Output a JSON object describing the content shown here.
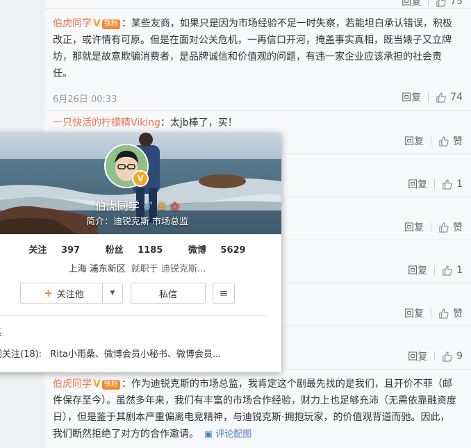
{
  "comments": [
    {
      "id": "top_partial",
      "likes": "75",
      "reply_label": "回复"
    },
    {
      "id": "c1",
      "user": "伯虎同学",
      "badge": "铁粉",
      "text": "：某些友商，如果只是因为市场经验不足一时失察，若能坦白承认错误，积极改正，或许情有可原。但是在面对公关危机，一再信口开河，掩盖事实真相，既当婊子又立牌坊，那就是故意欺骗消费者，是品牌诚信和价值观的问题，有违一家企业应该承担的社会责任。",
      "time": "6月26日 00:33",
      "reply_label": "回复",
      "likes": "74"
    },
    {
      "id": "c2",
      "user": "一只快活的柠檬精Viking",
      "text": "：太jb棒了，买！",
      "reply_label": "回复",
      "likes": "赞"
    },
    {
      "id": "c3",
      "reply_label": "回复",
      "likes": "1"
    },
    {
      "id": "c4",
      "reply_label": "回复",
      "likes": "赞"
    },
    {
      "id": "c5",
      "reply_label": "回复",
      "likes": "1"
    },
    {
      "id": "c6",
      "reply_label": "回复",
      "likes": "赞"
    },
    {
      "id": "c7",
      "reply_label": "回复",
      "likes": "9"
    },
    {
      "id": "c8",
      "user": "伯虎同学",
      "badge": "铁粉",
      "text": "：作为迪锐克斯的市场总监，我肯定这个剧最先找的是我们，且开价不菲（邮件保存至今）。虽然多年来，我们有丰富的市场合作经验，财力上也足够充沛（无需依靠融资度日），但是鉴于其剧本严重偏离电竞精神，与迪锐克斯·拥抱玩家，的价值观背道而驰。因此，我们断然拒绝了对方的合作邀请。",
      "link": "评论配图"
    }
  ],
  "card": {
    "name": "伯虎同学",
    "intro": "简介：迪锐克斯 市场总监",
    "following_label": "关注",
    "following": "397",
    "fans_label": "粉丝",
    "fans": "1185",
    "weibo_label": "微博",
    "weibo": "5629",
    "location": "上海 浦东新区",
    "job": "就职于 迪锐克斯...",
    "follow_btn": "关注他",
    "message_btn": "私信",
    "partial_line1": "系",
    "mutual": "同关注(18):",
    "mutual_list": "Rita小雨桑、微博会员小秘书、微博会员..."
  },
  "colors": {
    "username": "#eb7350",
    "link": "#4a80c8",
    "badge": "#f28a2b",
    "verified": "#f5a623"
  }
}
